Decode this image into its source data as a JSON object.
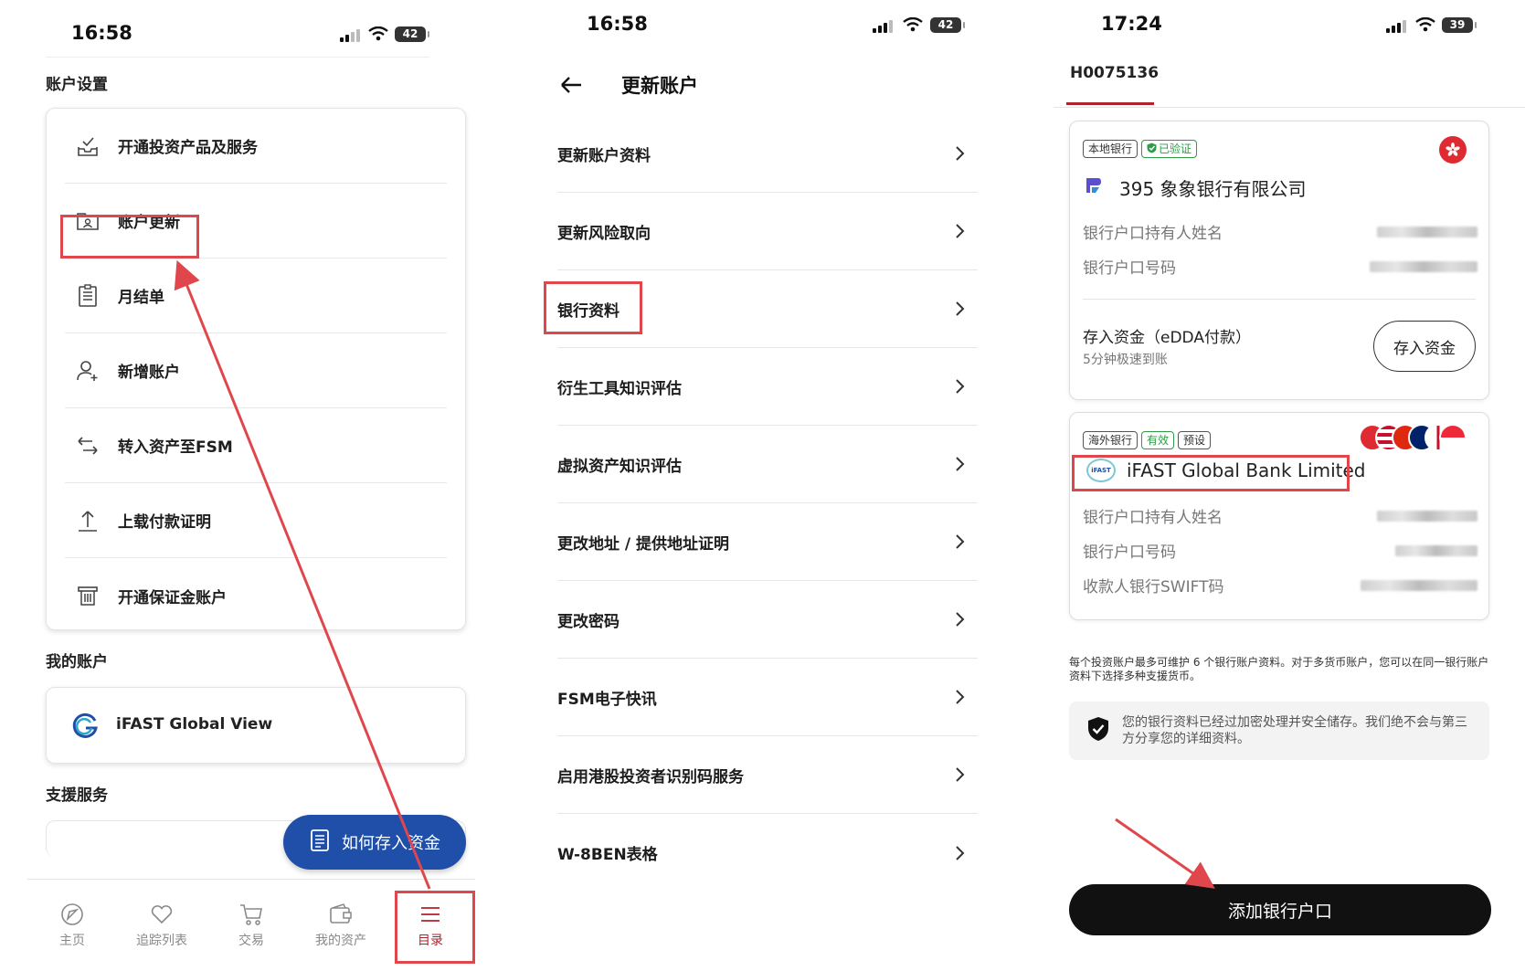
{
  "colors": {
    "accent_red": "#b0222c",
    "primary_blue": "#1f4fa8",
    "annotation_red": "#e0474c",
    "verified_green": "#2e9b46"
  },
  "panel1": {
    "status": {
      "time": "16:58",
      "battery": "42"
    },
    "account_settings_title": "账户设置",
    "settings_items": [
      {
        "label": "开通投资产品及服务",
        "icon": "inbox-check-icon"
      },
      {
        "label": "账户更新",
        "icon": "folder-user-icon"
      },
      {
        "label": "月结单",
        "icon": "statement-icon"
      },
      {
        "label": "新增账户",
        "icon": "user-add-icon"
      },
      {
        "label": "转入资产至FSM",
        "icon": "transfer-arrows-icon"
      },
      {
        "label": "上载付款证明",
        "icon": "upload-icon"
      },
      {
        "label": "开通保证金账户",
        "icon": "margin-icon"
      }
    ],
    "my_accounts_title": "我的账户",
    "global_view_label": "iFAST Global View",
    "support_title": "支援服务",
    "fab_label": "如何存入资金",
    "tabs": [
      {
        "label": "主页",
        "icon": "home-compass-icon"
      },
      {
        "label": "追踪列表",
        "icon": "heart-icon"
      },
      {
        "label": "交易",
        "icon": "cart-icon"
      },
      {
        "label": "我的资产",
        "icon": "wallet-icon"
      },
      {
        "label": "目录",
        "icon": "menu-icon"
      }
    ]
  },
  "panel2": {
    "status": {
      "time": "16:58",
      "battery": "42"
    },
    "title": "更新账户",
    "items": [
      "更新账户资料",
      "更新风险取向",
      "银行资料",
      "衍生工具知识评估",
      "虚拟资产知识评估",
      "更改地址 / 提供地址证明",
      "更改密码",
      "FSM电子快讯",
      "启用港股投资者识别码服务",
      "W-8BEN表格"
    ]
  },
  "panel3": {
    "status": {
      "time": "17:24",
      "battery": "39"
    },
    "account_id": "H0075136",
    "local_bank": {
      "tags": [
        "本地银行",
        "已验证"
      ],
      "name": "395 象象银行有限公司",
      "holder_label": "银行户口持有人姓名",
      "account_label": "银行户口号码",
      "deposit_title": "存入资金（eDDA付款）",
      "deposit_sub": "5分钟极速到账",
      "deposit_button": "存入资金"
    },
    "overseas_bank": {
      "tags": [
        "海外银行",
        "有效",
        "预设"
      ],
      "logo_text": "iFAST",
      "name": "iFAST Global Bank Limited",
      "holder_label": "银行户口持有人姓名",
      "account_label": "银行户口号码",
      "swift_label": "收款人银行SWIFT码"
    },
    "note": "每个投资账户最多可维护 6 个银行账户资料。对于多货币账户，您可以在同一银行账户资料下选择多种支援货币。",
    "secure_text": "您的银行资料已经过加密处理并安全储存。我们绝不会与第三方分享您的详细资料。",
    "add_button": "添加银行户口"
  }
}
